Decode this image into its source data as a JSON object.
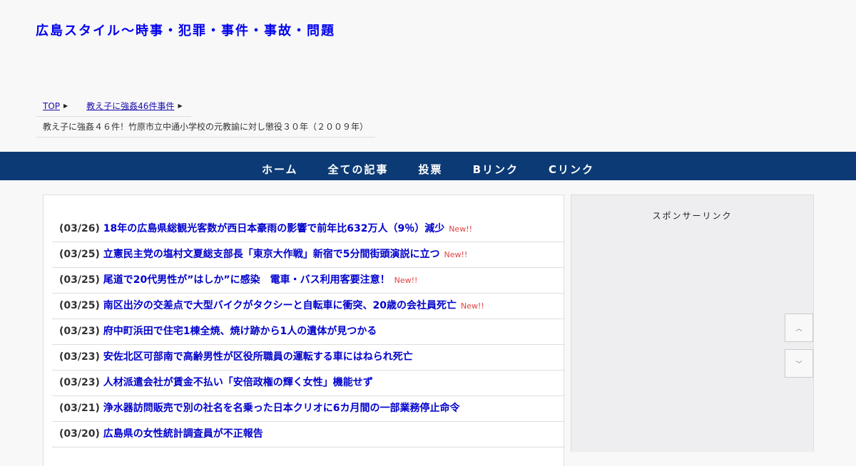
{
  "header": {
    "site_title": "広島スタイル～時事・犯罪・事件・事故・問題"
  },
  "breadcrumb": {
    "top": "TOP",
    "category": "教え子に強姦46件事件",
    "current": "教え子に強姦４６件！竹原市立中通小学校の元教諭に対し懲役３０年（２００９年）",
    "arrow_icon": "caret-right-icon"
  },
  "nav": {
    "items": [
      {
        "label": "ホーム"
      },
      {
        "label": "全ての記事"
      },
      {
        "label": "投票"
      },
      {
        "label": "Bリンク"
      },
      {
        "label": "Cリンク"
      }
    ]
  },
  "news": [
    {
      "date": "(03/26)",
      "title": "18年の広島県総観光客数が西日本豪雨の影響で前年比632万人（9％）減少",
      "badge": "New!!"
    },
    {
      "date": "(03/25)",
      "title": "立憲民主党の塩村文夏総支部長「東京大作戦」新宿で5分間街頭演説に立つ",
      "badge": "New!!"
    },
    {
      "date": "(03/25)",
      "title": "尾道で20代男性が”はしか”に感染　電車・バス利用客要注意！",
      "badge": "New!!"
    },
    {
      "date": "(03/25)",
      "title": "南区出汐の交差点で大型バイクがタクシーと自転車に衝突、20歳の会社員死亡",
      "badge": "New!!"
    },
    {
      "date": "(03/23)",
      "title": "府中町浜田で住宅1棟全焼、焼け跡から1人の遺体が見つかる",
      "badge": ""
    },
    {
      "date": "(03/23)",
      "title": "安佐北区可部南で高齢男性が区役所職員の運転する車にはねられ死亡",
      "badge": ""
    },
    {
      "date": "(03/23)",
      "title": "人材派遣会社が賃金不払い「安倍政権の輝く女性」機能せず",
      "badge": ""
    },
    {
      "date": "(03/21)",
      "title": "浄水器訪問販売で別の社名を名乗った日本クリオに6カ月間の一部業務停止命令",
      "badge": ""
    },
    {
      "date": "(03/20)",
      "title": "広島県の女性統計調査員が不正報告",
      "badge": ""
    }
  ],
  "sidebar": {
    "sponsor_label": "スポンサーリンク"
  },
  "scroll": {
    "up_icon": "chevron-up-icon",
    "down_icon": "chevron-down-icon"
  }
}
